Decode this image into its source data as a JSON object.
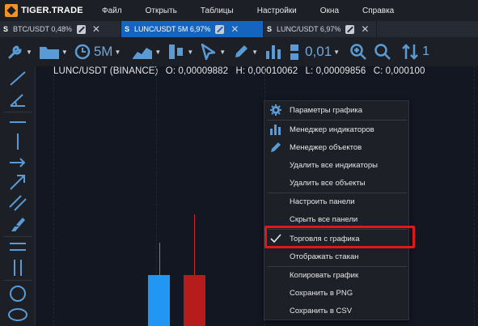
{
  "app": {
    "logo_text": "TIGER.TRADE"
  },
  "menu": [
    "Файл",
    "Открыть",
    "Таблицы",
    "Настройки",
    "Окна",
    "Справка"
  ],
  "tabs": [
    {
      "prefix": "S",
      "label": "BTC/USDT 0,48%",
      "active": false
    },
    {
      "prefix": "S",
      "label": "LUNC/USDT 5M 6,97%",
      "active": true
    },
    {
      "prefix": "S",
      "label": "LUNC/USDT 6,97%",
      "active": false
    }
  ],
  "toolbar": {
    "timeframe": "5M",
    "tick_size": "0,01",
    "trailing": "1"
  },
  "legend": {
    "pair": "LUNC/USDT (BINANCE)",
    "open": "O: 0,00009882",
    "high": "H: 0,00010062",
    "low": "L: 0,00009856",
    "close": "C: 0,000100"
  },
  "context_menu": {
    "items": [
      {
        "label": "Параметры графика",
        "icon": "gear-icon"
      },
      {
        "label": "Менеджер индикаторов",
        "icon": "bar-chart-icon"
      },
      {
        "label": "Менеджер объектов",
        "icon": "pencil-icon"
      },
      {
        "label": "Удалить все индикаторы",
        "icon": ""
      },
      {
        "label": "Удалить все объекты",
        "icon": ""
      },
      {
        "label": "Настроить панели",
        "icon": ""
      },
      {
        "label": "Скрыть все панели",
        "icon": ""
      },
      {
        "label": "Торговля с графика",
        "icon": "checkmark-icon",
        "checked": true
      },
      {
        "label": "Отображать стакан",
        "icon": ""
      },
      {
        "label": "Копировать график",
        "icon": ""
      },
      {
        "label": "Сохранить в PNG",
        "icon": ""
      },
      {
        "label": "Сохранить в CSV",
        "icon": ""
      }
    ]
  },
  "colors": {
    "accent": "#1565c0",
    "icon_blue": "#5b9bd5",
    "bull_candle": "#2196f3",
    "bear_candle": "#b71c1c",
    "highlight": "#e01818"
  }
}
